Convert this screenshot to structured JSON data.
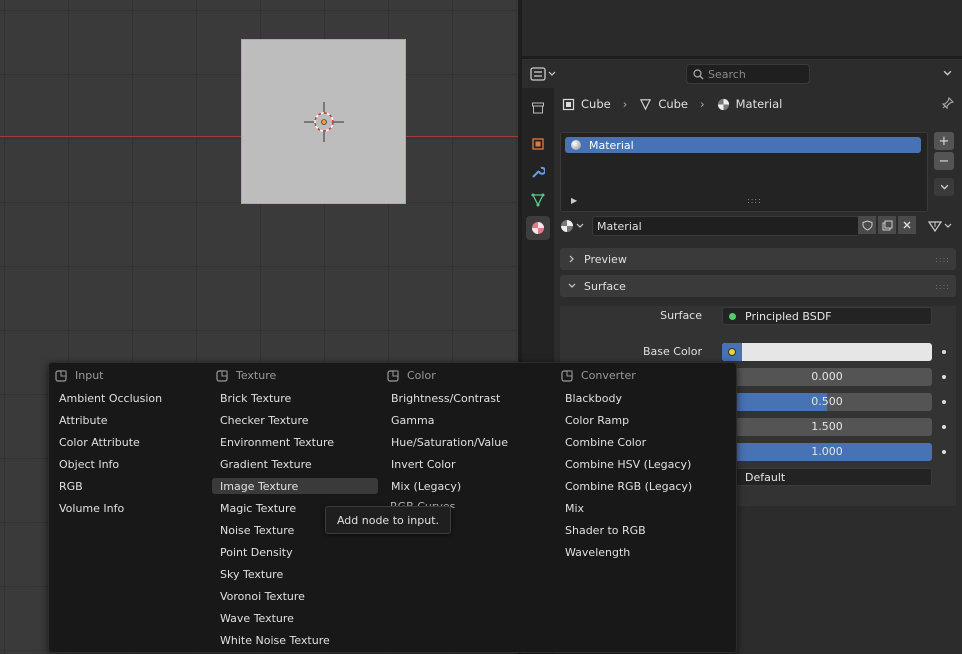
{
  "header": {
    "search_placeholder": "Search"
  },
  "breadcrumb": {
    "object": "Cube",
    "mesh": "Cube",
    "material": "Material"
  },
  "material_slots": {
    "items": [
      "Material"
    ],
    "add_label": "+",
    "remove_label": "−"
  },
  "slot_selector": {
    "name": "Material"
  },
  "panels": {
    "preview": "Preview",
    "surface": "Surface"
  },
  "surface": {
    "surface_label": "Surface",
    "surface_value": "Principled BSDF",
    "base_color_label": "Base Color",
    "fields": [
      {
        "value": "0.000",
        "fraction": 0
      },
      {
        "value": "0.500",
        "fraction": 0.5
      },
      {
        "value": "1.500",
        "fraction": 0
      },
      {
        "value": "1.000",
        "fraction": 1.0
      }
    ],
    "enum_value": "Default"
  },
  "menu": {
    "columns": [
      {
        "title": "Input",
        "items": [
          "Ambient Occlusion",
          "Attribute",
          "Color Attribute",
          "Object Info",
          "RGB",
          "Volume Info"
        ]
      },
      {
        "title": "Texture",
        "items": [
          "Brick Texture",
          "Checker Texture",
          "Environment Texture",
          "Gradient Texture",
          "Image Texture",
          "Magic Texture",
          "Noise Texture",
          "Point Density",
          "Sky Texture",
          "Voronoi Texture",
          "Wave Texture",
          "White Noise Texture"
        ],
        "highlighted": "Image Texture"
      },
      {
        "title": "Color",
        "items": [
          "Brightness/Contrast",
          "Gamma",
          "Hue/Saturation/Value",
          "Invert Color",
          "Mix (Legacy)"
        ]
      },
      {
        "title": "Converter",
        "items": [
          "Blackbody",
          "Color Ramp",
          "Combine Color",
          "Combine HSV (Legacy)",
          "Combine RGB (Legacy)",
          "Mix",
          "Shader to RGB",
          "Wavelength"
        ]
      }
    ]
  },
  "tooltip": {
    "text": "Add node to input."
  },
  "colors": {
    "accent": "#4772b3",
    "selection_outline": "#f29b3a",
    "x_axis": "#9e3b3b"
  }
}
